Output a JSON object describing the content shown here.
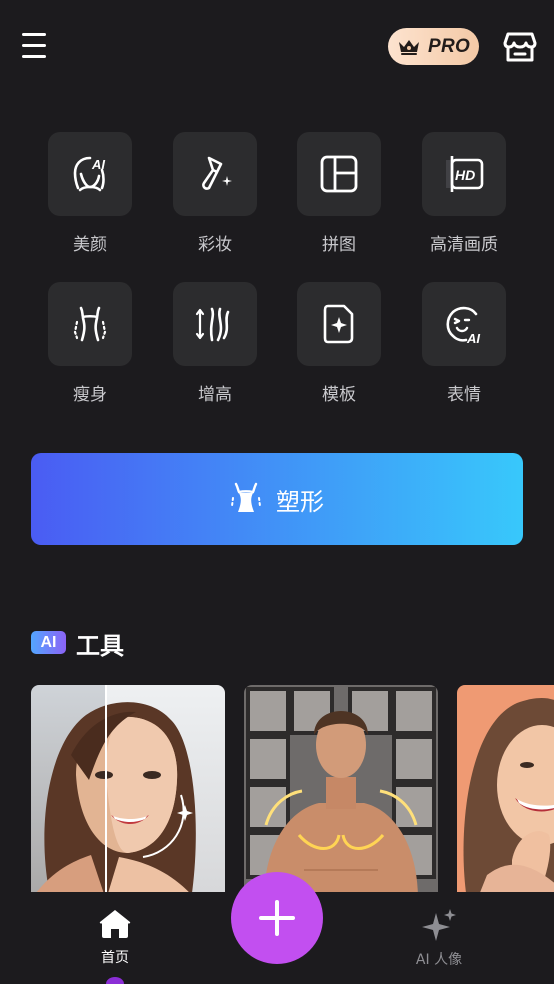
{
  "header": {
    "menu_icon": "hamburger-menu-icon",
    "pro_badge": {
      "icon": "crown-icon",
      "label": "PRO"
    },
    "store_icon": "store-icon"
  },
  "tools": [
    {
      "id": "beauty",
      "label": "美颜",
      "icon": "ai-face-icon"
    },
    {
      "id": "makeup",
      "label": "彩妆",
      "icon": "makeup-brush-icon"
    },
    {
      "id": "collage",
      "label": "拼图",
      "icon": "collage-icon"
    },
    {
      "id": "hd",
      "label": "高清画质",
      "icon": "hd-icon"
    },
    {
      "id": "slim",
      "label": "瘦身",
      "icon": "slim-body-icon"
    },
    {
      "id": "height",
      "label": "增高",
      "icon": "height-icon"
    },
    {
      "id": "template",
      "label": "模板",
      "icon": "template-icon"
    },
    {
      "id": "expression",
      "label": "表情",
      "icon": "ai-expression-icon"
    }
  ],
  "shape_button": {
    "label": "塑形",
    "icon": "body-shape-icon"
  },
  "ai_section": {
    "badge": "AI",
    "title": "工具",
    "cards": [
      {
        "id": "ai-beauty-compare",
        "icon": "woman-portrait-before-after"
      },
      {
        "id": "ai-muscle",
        "icon": "man-muscle-portrait"
      },
      {
        "id": "ai-smile",
        "icon": "woman-smile-portrait"
      }
    ]
  },
  "bottom_nav": {
    "items": [
      {
        "id": "home",
        "label": "首页",
        "icon": "home-icon",
        "active": true
      },
      {
        "id": "ai-portrait",
        "label": "AI 人像",
        "icon": "sparkle-icon",
        "active": false
      }
    ],
    "add_button_icon": "plus-icon"
  },
  "colors": {
    "background": "#1c1b1e",
    "tile": "#2c2c2e",
    "shape_gradient_start": "#4a5cf3",
    "shape_gradient_end": "#38c8fb",
    "fab": "#c24ff0",
    "pro_badge": "#f3c9a6",
    "active_indicator": "#8b2ed6"
  }
}
